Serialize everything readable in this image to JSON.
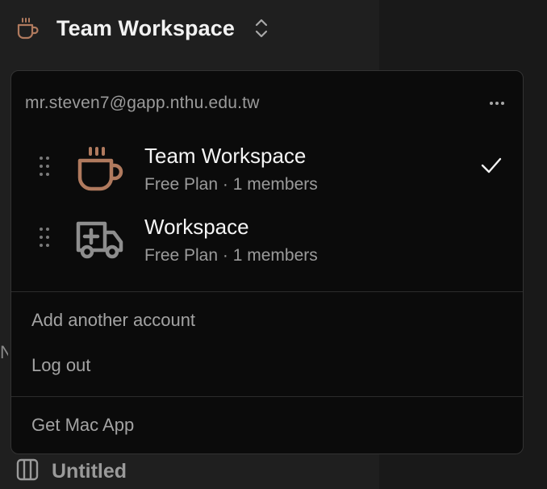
{
  "colors": {
    "accent_brown": "#b07a5e",
    "icon_gray": "#8e8e8e",
    "popup_bg": "#0b0b0b",
    "sidebar_bg": "#1f1f1f"
  },
  "header": {
    "icon": "coffee-cup-icon",
    "title": "Team Workspace",
    "switch_icon": "chevron-up-down-icon"
  },
  "sidebar": {
    "clipped_char": "N",
    "bottom_item": {
      "icon": "columns-icon",
      "label": "Untitled"
    }
  },
  "popup": {
    "account_email": "mr.steven7@gapp.nthu.edu.tw",
    "more_icon": "ellipsis-icon",
    "workspaces": [
      {
        "name": "Team Workspace",
        "subtitle": "Free Plan · 1 members",
        "icon": "coffee-cup-icon",
        "selected": true
      },
      {
        "name": "Workspace",
        "subtitle": "Free Plan · 1 members",
        "icon": "ambulance-icon",
        "selected": false
      }
    ],
    "menu": {
      "add_account": "Add another account",
      "log_out": "Log out",
      "get_mac_app": "Get Mac App"
    }
  }
}
